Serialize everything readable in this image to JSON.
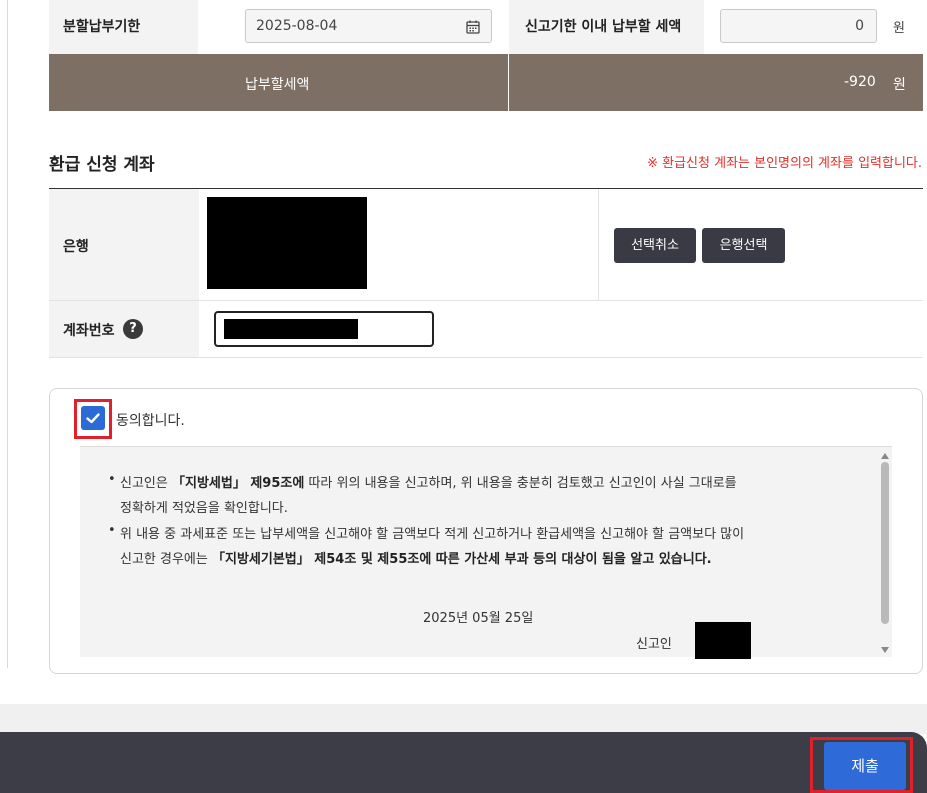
{
  "summary": {
    "installment_deadline_label": "분할납부기한",
    "installment_deadline_value": "2025-08-04",
    "due_within_deadline_label": "신고기한 이내 납부할 세액",
    "due_within_deadline_value": "0",
    "due_within_deadline_unit": "원",
    "payable_label": "납부할세액",
    "payable_value": "-920",
    "payable_unit": "원"
  },
  "refund_account": {
    "title": "환급 신청 계좌",
    "note": "※ 환급신청 계좌는 본인명의의 계좌를 입력합니다.",
    "bank_label": "은행",
    "cancel_selection_label": "선택취소",
    "select_bank_label": "은행선택",
    "account_number_label": "계좌번호",
    "help_glyph": "?"
  },
  "agreement": {
    "checkbox_label": "동의합니다.",
    "checked": true,
    "bullet1_pre": "신고인은 ",
    "bullet1_law": "「지방세법」 제95조에",
    "bullet1_post": " 따라 위의 내용을 신고하며, 위 내용을 충분히 검토했고 신고인이 사실 그대로를",
    "bullet1_line2": "정확하게 적었음을 확인합니다.",
    "bullet2_line1": "위 내용 중 과세표준 또는 납부세액을 신고해야 할 금액보다 적게 신고하거나 환급세액을 신고해야 할 금액보다 많이",
    "bullet2_pre": "신고한 경우에는 ",
    "bullet2_bold": "「지방세기본법」 제54조 및 제55조에 따른 가산세 부과 등의 대상이 됨을 알고 있습니다.",
    "date": "2025년 05월 25일",
    "reporter_label": "신고인"
  },
  "footer": {
    "submit_label": "제출"
  },
  "colors": {
    "header_brown": "#7e6f65",
    "accent_blue": "#2f6ad9",
    "highlight_red": "#e0202a",
    "note_red": "#e0302a",
    "footer_dark": "#3d3d48"
  }
}
